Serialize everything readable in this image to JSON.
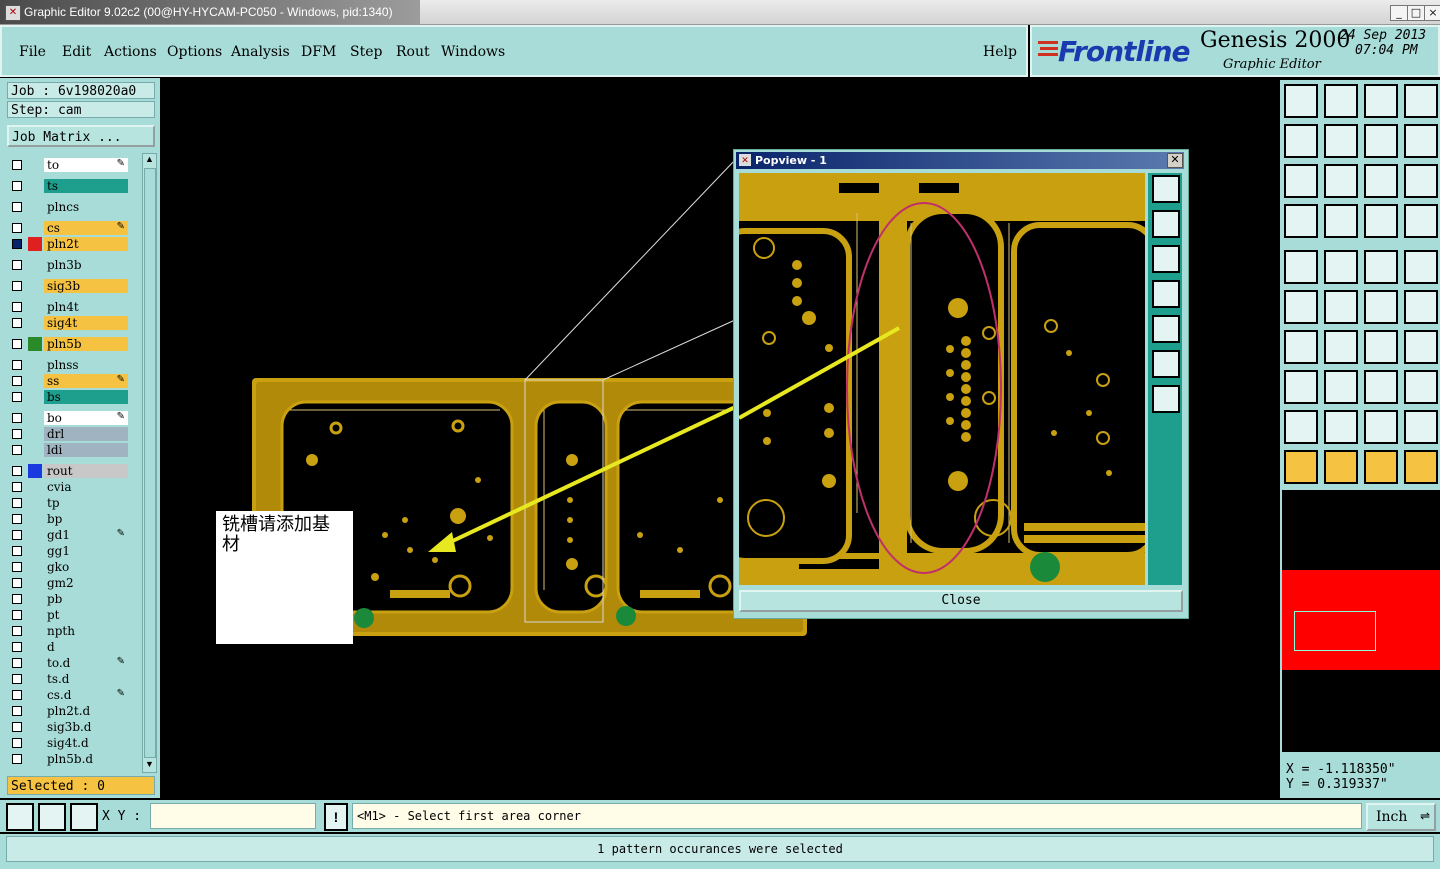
{
  "window": {
    "title": "Graphic Editor 9.02c2 (00@HY-HYCAM-PC050 - Windows, pid:1340)",
    "controls": [
      "_",
      "□",
      "×"
    ]
  },
  "menu": {
    "items": [
      "File",
      "Edit",
      "Actions",
      "Options",
      "Analysis",
      "DFM",
      "Step",
      "Rout",
      "Windows"
    ],
    "help": "Help"
  },
  "brand": {
    "logo": "Frontline",
    "product": "Genesis 2000",
    "subtitle": "Graphic Editor",
    "date": "24 Sep 2013",
    "time": "07:04 PM"
  },
  "job": {
    "job_line": "Job : 6v198020a0",
    "step_line": "Step: cam",
    "matrix_button": "Job Matrix ..."
  },
  "layers": [
    {
      "name": "to",
      "color": "#ffffff",
      "swatch": "",
      "edit": true
    },
    {
      "name": "ts",
      "color": "#1e9e8c",
      "swatch": "",
      "edit": false
    },
    {
      "name": "plncs",
      "color": "#a8dcd8",
      "swatch": "",
      "edit": false
    },
    {
      "name": "cs",
      "color": "#f5c242",
      "swatch": "",
      "edit": true
    },
    {
      "name": "pln2t",
      "color": "#f5c242",
      "swatch": "#e02020",
      "edit": false,
      "checked": true
    },
    {
      "name": "pln3b",
      "color": "#a8dcd8",
      "swatch": "",
      "edit": false
    },
    {
      "name": "sig3b",
      "color": "#f5c242",
      "swatch": "",
      "edit": false
    },
    {
      "name": "pln4t",
      "color": "#a8dcd8",
      "swatch": "",
      "edit": false
    },
    {
      "name": "sig4t",
      "color": "#f5c242",
      "swatch": "",
      "edit": false
    },
    {
      "name": "pln5b",
      "color": "#f5c242",
      "swatch": "#2a8a2a",
      "edit": false
    },
    {
      "name": "plnss",
      "color": "#a8dcd8",
      "swatch": "",
      "edit": false
    },
    {
      "name": "ss",
      "color": "#f5c242",
      "swatch": "",
      "edit": true
    },
    {
      "name": "bs",
      "color": "#1e9e8c",
      "swatch": "",
      "edit": false
    },
    {
      "name": "bo",
      "color": "#ffffff",
      "swatch": "",
      "edit": true
    },
    {
      "name": "drl",
      "color": "#9fb4c0",
      "swatch": "",
      "edit": false
    },
    {
      "name": "ldi",
      "color": "#9fb4c0",
      "swatch": "",
      "edit": false
    },
    {
      "name": "rout",
      "color": "#c8c8c8",
      "swatch": "#1a3ae0",
      "edit": false
    },
    {
      "name": "cvia",
      "color": "#a8dcd8",
      "swatch": "",
      "edit": false
    },
    {
      "name": "tp",
      "color": "#a8dcd8",
      "swatch": "",
      "edit": false
    },
    {
      "name": "bp",
      "color": "#a8dcd8",
      "swatch": "",
      "edit": false
    },
    {
      "name": "gd1",
      "color": "#a8dcd8",
      "swatch": "",
      "edit": true
    },
    {
      "name": "gg1",
      "color": "#a8dcd8",
      "swatch": "",
      "edit": false
    },
    {
      "name": "gko",
      "color": "#a8dcd8",
      "swatch": "",
      "edit": false
    },
    {
      "name": "gm2",
      "color": "#a8dcd8",
      "swatch": "",
      "edit": false
    },
    {
      "name": "pb",
      "color": "#a8dcd8",
      "swatch": "",
      "edit": false
    },
    {
      "name": "pt",
      "color": "#a8dcd8",
      "swatch": "",
      "edit": false
    },
    {
      "name": "npth",
      "color": "#a8dcd8",
      "swatch": "",
      "edit": false
    },
    {
      "name": "d",
      "color": "#a8dcd8",
      "swatch": "",
      "edit": false
    },
    {
      "name": "to.d",
      "color": "#a8dcd8",
      "swatch": "",
      "edit": true
    },
    {
      "name": "ts.d",
      "color": "#a8dcd8",
      "swatch": "",
      "edit": false
    },
    {
      "name": "cs.d",
      "color": "#a8dcd8",
      "swatch": "",
      "edit": true
    },
    {
      "name": "pln2t.d",
      "color": "#a8dcd8",
      "swatch": "",
      "edit": false
    },
    {
      "name": "sig3b.d",
      "color": "#a8dcd8",
      "swatch": "",
      "edit": false
    },
    {
      "name": "sig4t.d",
      "color": "#a8dcd8",
      "swatch": "",
      "edit": false
    },
    {
      "name": "pln5b.d",
      "color": "#a8dcd8",
      "swatch": "",
      "edit": false
    }
  ],
  "selected": "Selected : 0",
  "annotation": {
    "note": "铣槽请添加基材"
  },
  "popview": {
    "title": "Popview - 1",
    "close_label": "Close"
  },
  "coords": {
    "x": "X = -1.118350\"",
    "y": "Y = 0.319337\""
  },
  "command": {
    "xy_label": "X Y :",
    "xy_value": "",
    "prompt": "<M1> - Select first area corner",
    "units": "Inch"
  },
  "status": "1 pattern occurances were selected",
  "colors": {
    "panel": "#a8dcd8",
    "copper": "#c8a010",
    "annotation_arrow": "#e8e820",
    "highlight_ellipse": "#c0306a"
  }
}
